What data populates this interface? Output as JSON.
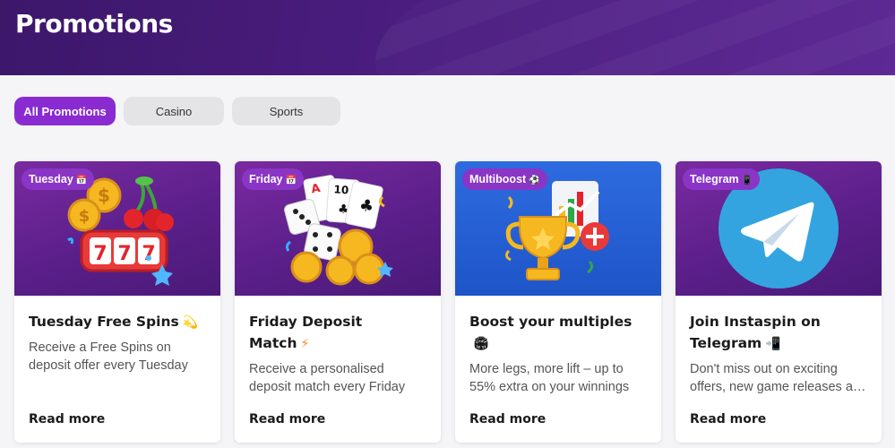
{
  "header": {
    "title": "Promotions"
  },
  "filters": {
    "tabs": [
      {
        "label": "All Promotions",
        "active": true
      },
      {
        "label": "Casino",
        "active": false
      },
      {
        "label": "Sports",
        "active": false
      }
    ]
  },
  "promotions": [
    {
      "badge": "Tuesday",
      "badge_icon": "calendar-icon",
      "title": "Tuesday Free Spins",
      "title_icon": "dizzy-star-icon",
      "description": "Receive a Free Spins on deposit offer every Tuesday",
      "link": "Read more",
      "image": "slot-machine-777-coins-cherries"
    },
    {
      "badge": "Friday",
      "badge_icon": "calendar-icon",
      "title": "Friday Deposit Match",
      "title_icon": "lightning-icon",
      "description": "Receive a personalised deposit match every Friday",
      "link": "Read more",
      "image": "dice-cards-coins"
    },
    {
      "badge": "Multiboost",
      "badge_icon": "globe-icon",
      "title": "Boost your multiples",
      "title_icon": "stadium-icon",
      "description": "More legs, more lift – up to 55% extra on your winnings",
      "link": "Read more",
      "image": "trophy-chart-plus"
    },
    {
      "badge": "Telegram",
      "badge_icon": "phone-icon",
      "title": "Join Instaspin on Telegram",
      "title_icon": "mobile-phone-icon",
      "description": "Don't miss out on exciting offers, new game releases and more",
      "link": "Read more",
      "image": "telegram-logo"
    }
  ],
  "colors": {
    "header_bg": "#4a1d7f",
    "accent": "#8a2bd2",
    "badge_bg": "#8a35c6",
    "card_bg": "#ffffff"
  }
}
